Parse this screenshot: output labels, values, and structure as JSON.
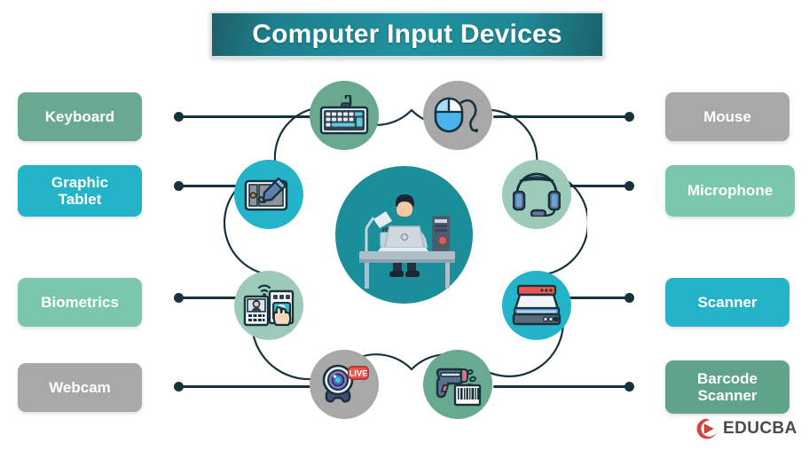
{
  "title": {
    "text": "Computer Input Devices"
  },
  "theme": {
    "banner_dark": "#1d5f68",
    "banner_light": "#20919e",
    "line": "#16323c",
    "center_teal": "#1a8e99",
    "green": "#69a98f",
    "mint": "#9ecbb9",
    "cyan": "#24b4ca",
    "gray": "#a8a8a8",
    "dark_green": "#5fa389",
    "logo_red": "#d6453e"
  },
  "left_items": [
    {
      "label": "Keyboard",
      "color": "#69a98f",
      "icon": "keyboard-icon",
      "circle_color": "#69a98f"
    },
    {
      "label": "Graphic\nTablet",
      "color": "#24b4ca",
      "icon": "graphic-tablet-icon",
      "circle_color": "#24b4ca"
    },
    {
      "label": "Biometrics",
      "color": "#7ac7ab",
      "icon": "biometrics-icon",
      "circle_color": "#9ecbb9"
    },
    {
      "label": "Webcam",
      "color": "#a8a8a8",
      "icon": "webcam-icon",
      "circle_color": "#a8a8a8"
    }
  ],
  "right_items": [
    {
      "label": "Mouse",
      "color": "#a8a8a8",
      "icon": "mouse-icon",
      "circle_color": "#a8a8a8"
    },
    {
      "label": "Microphone",
      "color": "#7ac7ab",
      "icon": "headset-microphone-icon",
      "circle_color": "#9ecbb9"
    },
    {
      "label": "Scanner",
      "color": "#24b4ca",
      "icon": "flatbed-scanner-icon",
      "circle_color": "#24b4ca"
    },
    {
      "label": "Barcode\nScanner",
      "color": "#5fa389",
      "icon": "barcode-scanner-icon",
      "circle_color": "#69a98f"
    }
  ],
  "labels": {
    "keyboard": "Keyboard",
    "graphic_tablet_line1": "Graphic",
    "graphic_tablet_line2": "Tablet",
    "biometrics": "Biometrics",
    "webcam": "Webcam",
    "mouse": "Mouse",
    "microphone": "Microphone",
    "scanner": "Scanner",
    "barcode_line1": "Barcode",
    "barcode_line2": "Scanner"
  },
  "center": {
    "icon": "person-at-desk-with-computer-icon"
  },
  "logo": {
    "text": "EDUCBA",
    "mark": "educba-play-circle-icon"
  }
}
